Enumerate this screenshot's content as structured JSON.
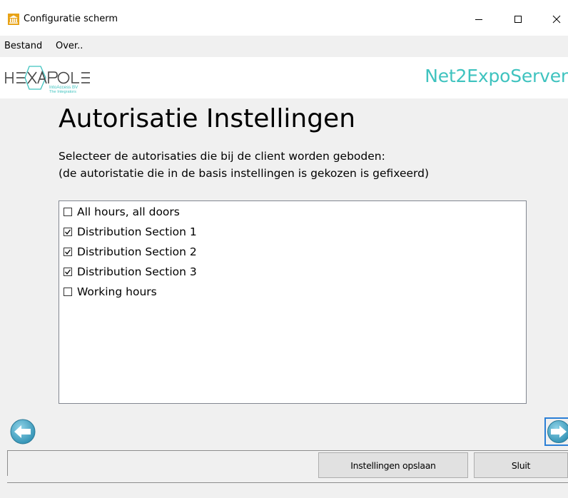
{
  "window": {
    "title": "Configuratie scherm",
    "icon": "museum-icon"
  },
  "menu": {
    "items": [
      "Bestand",
      "Over.."
    ]
  },
  "header": {
    "logo": {
      "name": "HEXAPOLE",
      "sub1": "IntoAccess BV",
      "sub2": "The Integrators"
    },
    "product": "Net2ExpoServer",
    "accent_color": "#3fc3bf"
  },
  "page": {
    "title": "Autorisatie Instellingen",
    "description_line1": "Selecteer de autorisaties die bij de client worden geboden:",
    "description_line2": "(de autoristatie die in de basis instellingen is gekozen is gefixeerd)"
  },
  "authorizations": [
    {
      "label": "All hours, all doors",
      "checked": false
    },
    {
      "label": "Distribution Section 1",
      "checked": true
    },
    {
      "label": "Distribution Section 2",
      "checked": true
    },
    {
      "label": "Distribution Section 3",
      "checked": true
    },
    {
      "label": "Working hours",
      "checked": false
    }
  ],
  "navigation": {
    "prev_icon": "arrow-left-circle-icon",
    "next_icon": "arrow-right-circle-icon"
  },
  "buttons": {
    "save": "Instellingen opslaan",
    "close": "Sluit"
  }
}
